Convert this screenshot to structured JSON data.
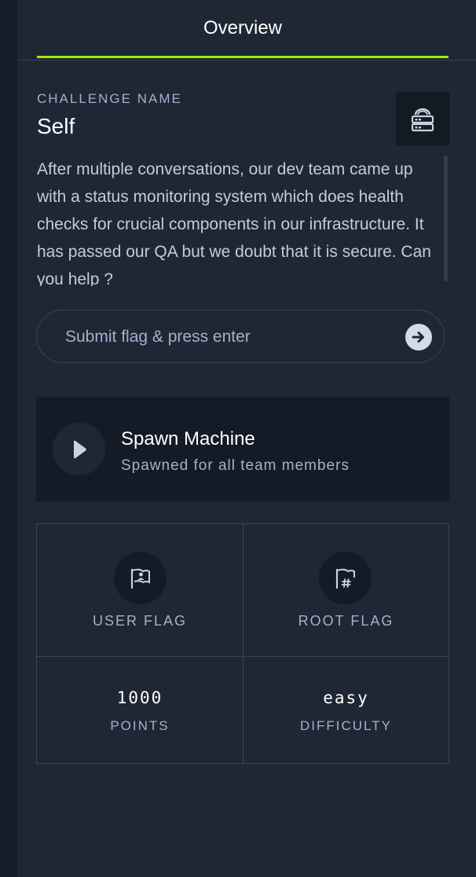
{
  "tab": {
    "label": "Overview"
  },
  "challenge": {
    "caption": "CHALLENGE NAME",
    "name": "Self",
    "description": "After multiple conversations, our dev team came up with a status monitoring system which does health checks for crucial components in our infrastructure. It has passed our QA but we doubt that it is secure. Can you help ?"
  },
  "flag_input": {
    "placeholder": "Submit flag & press enter"
  },
  "spawn": {
    "title": "Spawn Machine",
    "subtitle": "Spawned for all team members"
  },
  "stats": {
    "user_flag_label": "USER FLAG",
    "root_flag_label": "ROOT FLAG",
    "points_value": "1000",
    "points_label": "POINTS",
    "difficulty_value": "easy",
    "difficulty_label": "DIFFICULTY"
  },
  "icons": {
    "server": "server-icon",
    "submit": "arrow-right-icon",
    "play": "play-icon",
    "user_flag": "user-flag-icon",
    "root_flag": "root-flag-icon"
  },
  "colors": {
    "accent": "#9fef00",
    "background": "#1f2634",
    "card": "#151b26"
  }
}
